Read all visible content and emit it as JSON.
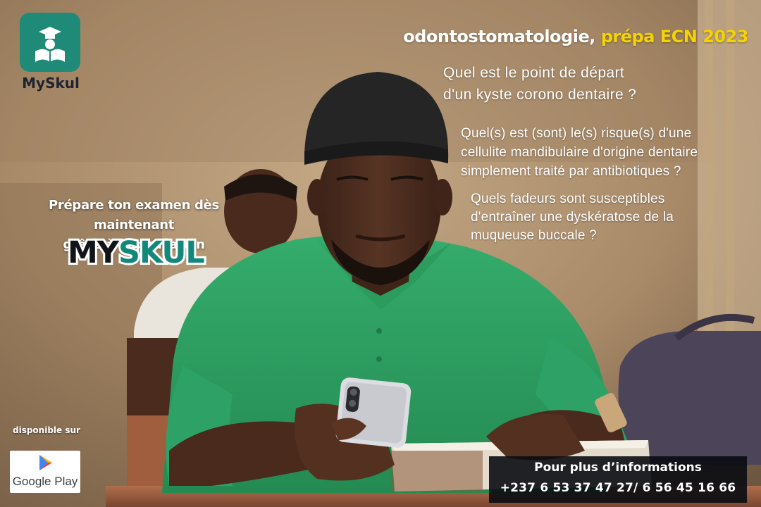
{
  "logo": {
    "name": "MySkul",
    "icon": "graduate-reading-icon",
    "tile_color": "#1f8a78"
  },
  "header": {
    "subject": "odontostomatologie,",
    "highlight": "prépa ECN 2023",
    "highlight_color": "#f5d400"
  },
  "questions": [
    {
      "lines": [
        "Quel est le point de départ",
        "d'un kyste corono dentaire ?"
      ]
    },
    {
      "lines": [
        "Quel(s) est (sont) le(s) risque(s) d'une",
        "cellulite mandibulaire d'origine dentaire",
        "simplement traité par antibiotiques ?"
      ]
    },
    {
      "lines": [
        "Quels fadeurs sont susceptibles",
        "d'entraîner une dyskératose de la",
        "muqueuse buccale ?"
      ]
    }
  ],
  "promo": {
    "lines": [
      "Prépare ton examen dès maintenant",
      "grâce à l’application"
    ],
    "brand_part1": "MY",
    "brand_part2": "SKUL",
    "brand_color_1": "#111418",
    "brand_color_2": "#12887a"
  },
  "store": {
    "available_label": "disponible sur",
    "badge_label": "Google Play",
    "icon": "google-play-icon"
  },
  "contact": {
    "title": "Pour plus d’informations",
    "phones": "+237 6 53 37 47 27/ 6 56 45 16 66"
  },
  "photo": {
    "description_icon": "student-with-smartphone-photo",
    "background_color": "#b09170",
    "shirt_color": "#2f9f63",
    "beanie_color": "#222222"
  }
}
